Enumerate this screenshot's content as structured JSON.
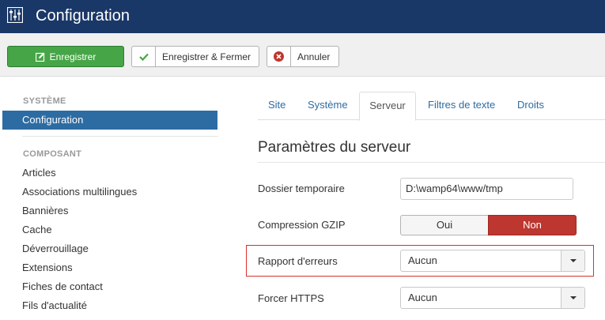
{
  "header": {
    "title": "Configuration",
    "icon": "equalizer-icon"
  },
  "toolbar": {
    "save_label": "Enregistrer",
    "save_close_label": "Enregistrer & Fermer",
    "cancel_label": "Annuler"
  },
  "sidebar": {
    "system_heading": "SYSTÈME",
    "active_item": "Configuration",
    "component_heading": "COMPOSANT",
    "items": [
      "Articles",
      "Associations multilingues",
      "Bannières",
      "Cache",
      "Déverrouillage",
      "Extensions",
      "Fiches de contact",
      "Fils d'actualité"
    ]
  },
  "tabs": [
    "Site",
    "Système",
    "Serveur",
    "Filtres de texte",
    "Droits"
  ],
  "active_tab": "Serveur",
  "main": {
    "section_title": "Paramètres du serveur",
    "fields": {
      "temp_dir_label": "Dossier temporaire",
      "temp_dir_value": "D:\\wamp64\\www/tmp",
      "gzip_label": "Compression GZIP",
      "gzip_yes": "Oui",
      "gzip_no": "Non",
      "error_label": "Rapport d'erreurs",
      "error_value": "Aucun",
      "https_label": "Forcer HTTPS",
      "https_value": "Aucun"
    }
  },
  "colors": {
    "header_bg": "#1a3867",
    "save_green": "#46a546",
    "active_blue": "#2d6ca2",
    "toggle_red": "#bd362f",
    "highlight_red": "#d7322b"
  }
}
